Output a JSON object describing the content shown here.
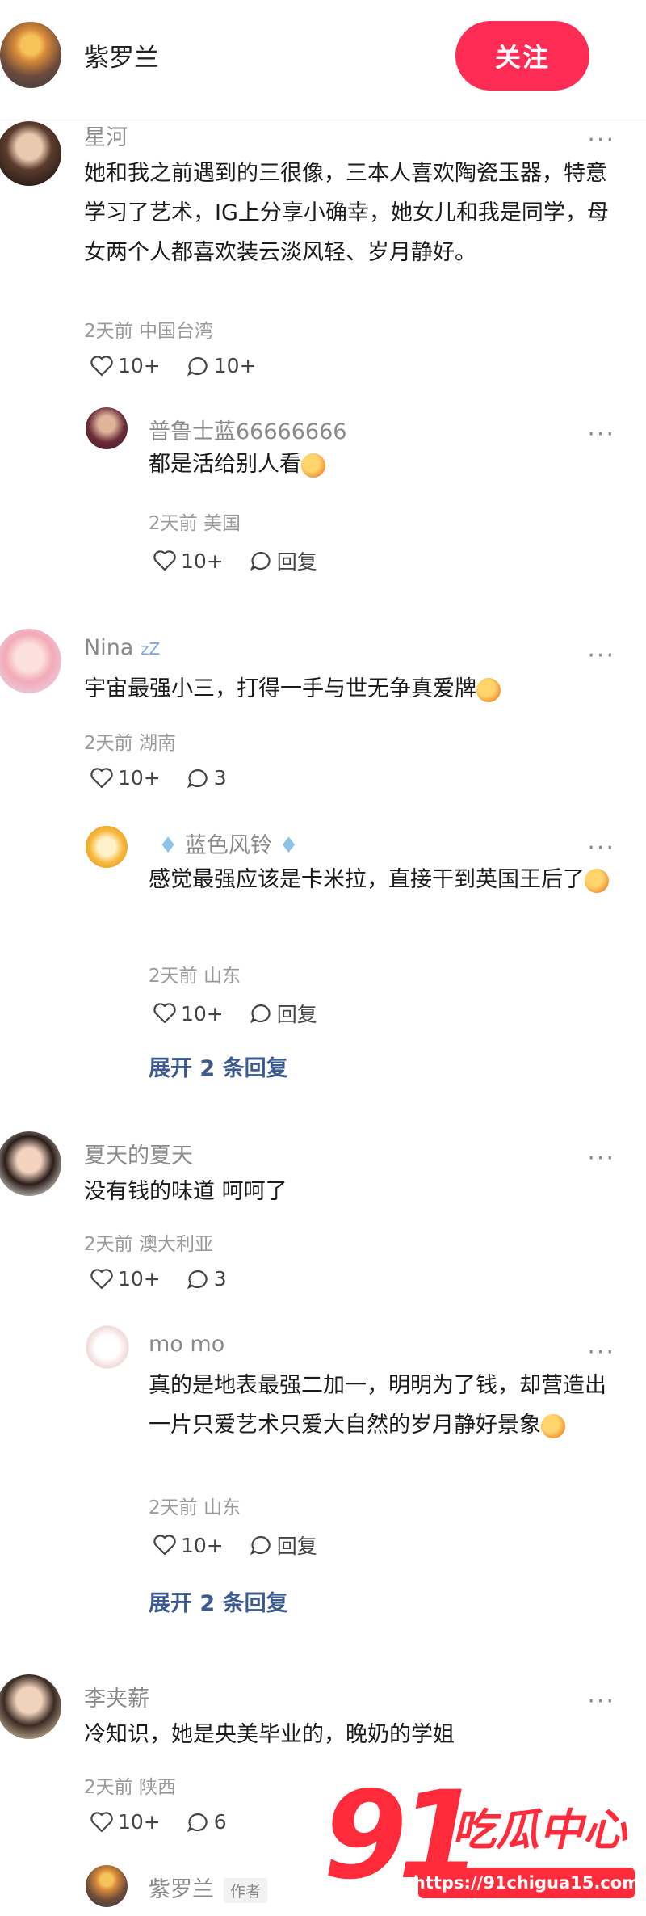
{
  "header": {
    "username": "紫罗兰",
    "follow_label": "关注"
  },
  "comments": [
    {
      "name": "星河",
      "text": "她和我之前遇到的三很像，三本人喜欢陶瓷玉器，特意学习了艺术，IG上分享小确幸，她女儿和我是同学，母女两个人都喜欢装云淡风轻、岁月静好。",
      "time": "2天前",
      "location": "中国台湾",
      "likes": "10+",
      "replies": "10+",
      "reply": {
        "name": "普鲁士蓝66666666",
        "text": "都是活给别人看",
        "time": "2天前",
        "location": "美国",
        "likes": "10+",
        "reply_label": "回复"
      }
    },
    {
      "name": "Nina",
      "text": "宇宙最强小三，打得一手与世无争真爱牌",
      "time": "2天前",
      "location": "湖南",
      "likes": "10+",
      "replies": "3",
      "reply": {
        "name": "蓝色风铃",
        "text": "感觉最强应该是卡米拉，直接干到英国王后了",
        "time": "2天前",
        "location": "山东",
        "likes": "10+",
        "reply_label": "回复"
      },
      "expand_label": "展开 2 条回复"
    },
    {
      "name": "夏天的夏天",
      "text": "没有钱的味道 呵呵了",
      "time": "2天前",
      "location": "澳大利亚",
      "likes": "10+",
      "replies": "3",
      "reply": {
        "name": "mo mo",
        "text": "真的是地表最强二加一，明明为了钱，却营造出一片只爱艺术只爱大自然的岁月静好景象",
        "time": "2天前",
        "location": "山东",
        "likes": "10+",
        "reply_label": "回复"
      },
      "expand_label": "展开 2 条回复"
    },
    {
      "name": "李夹薪",
      "text": "冷知识，她是央美毕业的，晚奶的学姐",
      "time": "2天前",
      "location": "陕西",
      "likes": "10+",
      "replies": "6",
      "reply": {
        "name": "紫罗兰",
        "author_tag": "作者"
      }
    }
  ],
  "watermark": {
    "number": "91",
    "brand": "吃瓜中心",
    "url": "https://91chigua15.com"
  },
  "icons": [
    "heart-icon",
    "comment-bubble-icon",
    "more-icon",
    "ice-icon",
    "bell-icon"
  ]
}
